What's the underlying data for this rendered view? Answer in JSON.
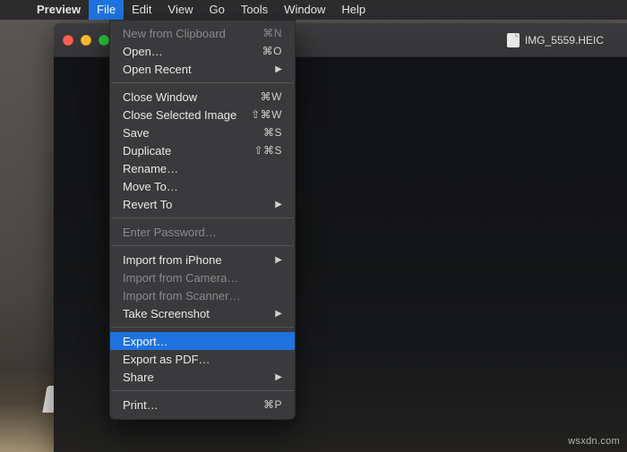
{
  "menubar": {
    "app": "Preview",
    "items": [
      "File",
      "Edit",
      "View",
      "Go",
      "Tools",
      "Window",
      "Help"
    ],
    "open_index": 0
  },
  "window": {
    "document_name": "IMG_5559.HEIC"
  },
  "dropdown": {
    "sections": [
      [
        {
          "label": "New from Clipboard",
          "shortcut": "⌘N",
          "disabled": true
        },
        {
          "label": "Open…",
          "shortcut": "⌘O"
        },
        {
          "label": "Open Recent",
          "submenu": true
        }
      ],
      [
        {
          "label": "Close Window",
          "shortcut": "⌘W"
        },
        {
          "label": "Close Selected Image",
          "shortcut": "⇧⌘W"
        },
        {
          "label": "Save",
          "shortcut": "⌘S"
        },
        {
          "label": "Duplicate",
          "shortcut": "⇧⌘S"
        },
        {
          "label": "Rename…"
        },
        {
          "label": "Move To…"
        },
        {
          "label": "Revert To",
          "submenu": true
        }
      ],
      [
        {
          "label": "Enter Password…",
          "disabled": true
        }
      ],
      [
        {
          "label": "Import from iPhone",
          "submenu": true
        },
        {
          "label": "Import from Camera…",
          "disabled": true
        },
        {
          "label": "Import from Scanner…",
          "disabled": true
        },
        {
          "label": "Take Screenshot",
          "submenu": true
        }
      ],
      [
        {
          "label": "Export…",
          "highlight": true
        },
        {
          "label": "Export as PDF…"
        },
        {
          "label": "Share",
          "submenu": true
        }
      ],
      [
        {
          "label": "Print…",
          "shortcut": "⌘P"
        }
      ]
    ]
  },
  "watermark": "wsxdn.com"
}
